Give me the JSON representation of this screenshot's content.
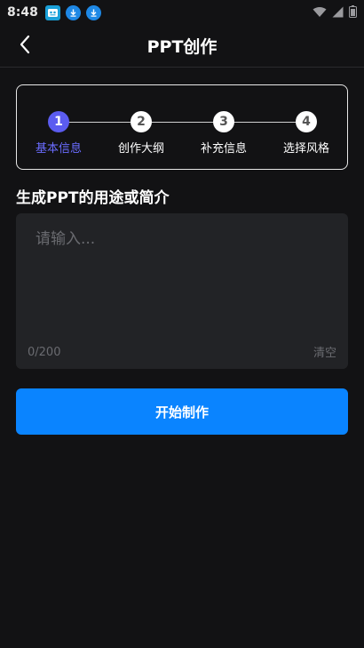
{
  "status_bar": {
    "time": "8:48",
    "icons": [
      "app-icon",
      "download-icon",
      "download-icon",
      "wifi-icon",
      "signal-icon",
      "battery-icon"
    ]
  },
  "nav": {
    "title": "PPT创作",
    "back_icon": "chevron-left-icon"
  },
  "stepper": {
    "active_index": 0,
    "steps": [
      {
        "number": "1",
        "label": "基本信息"
      },
      {
        "number": "2",
        "label": "创作大纲"
      },
      {
        "number": "3",
        "label": "补充信息"
      },
      {
        "number": "4",
        "label": "选择风格"
      }
    ]
  },
  "form": {
    "section_title": "生成PPT的用途或简介",
    "placeholder": "请输入...",
    "value": "",
    "counter": "0/200",
    "clear_label": "清空"
  },
  "actions": {
    "start_label": "开始制作"
  },
  "colors": {
    "background": "#121214",
    "accent": "#0a84ff",
    "step_active": "#5b5cf0",
    "input_bg": "#222326"
  }
}
